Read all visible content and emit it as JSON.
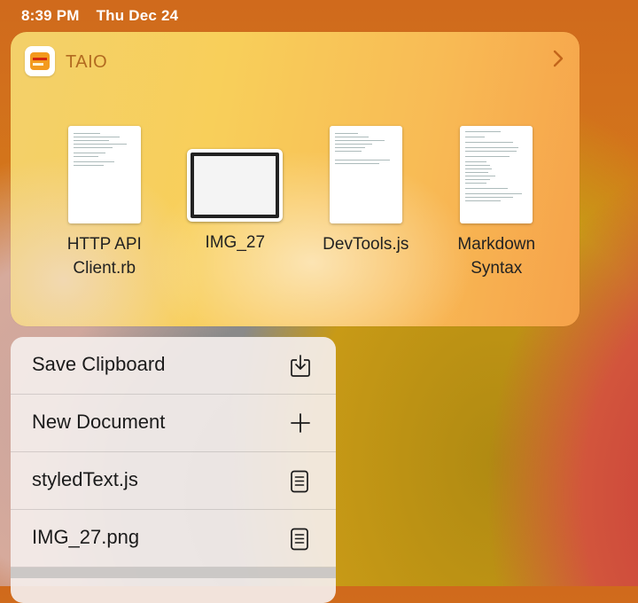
{
  "status_bar": {
    "time": "8:39 PM",
    "date": "Thu Dec 24"
  },
  "widget": {
    "app_name": "TAIO",
    "files": [
      {
        "name_line1": "HTTP API",
        "name_line2": "Client.rb",
        "kind": "document"
      },
      {
        "name_line1": "IMG_27",
        "name_line2": "",
        "kind": "image"
      },
      {
        "name_line1": "DevTools.js",
        "name_line2": "",
        "kind": "document"
      },
      {
        "name_line1": "Markdown",
        "name_line2": "Syntax",
        "kind": "document"
      }
    ]
  },
  "menu": {
    "items": [
      {
        "label": "Save Clipboard",
        "icon": "save-clipboard-icon"
      },
      {
        "label": "New Document",
        "icon": "plus-icon"
      },
      {
        "label": "styledText.js",
        "icon": "document-icon"
      },
      {
        "label": "IMG_27.png",
        "icon": "document-icon"
      }
    ]
  },
  "colors": {
    "accent_text": "#b26a20",
    "chevron": "#c2651a"
  }
}
